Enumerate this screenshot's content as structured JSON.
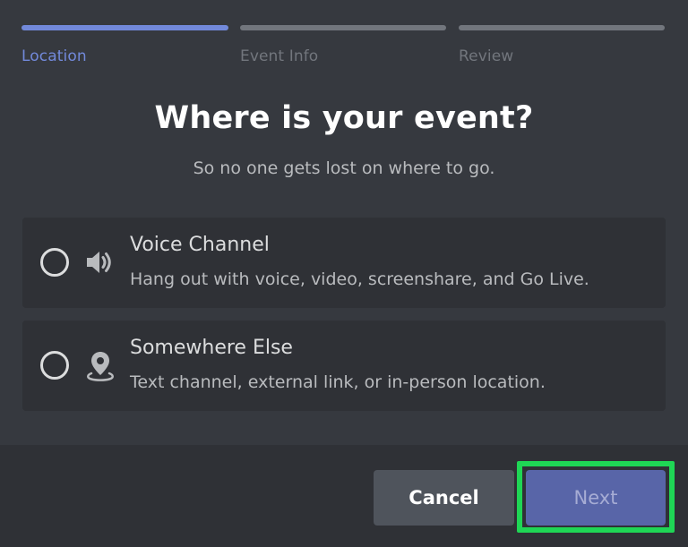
{
  "stepper": {
    "steps": [
      {
        "label": "Location",
        "active": true
      },
      {
        "label": "Event Info",
        "active": false
      },
      {
        "label": "Review",
        "active": false
      }
    ]
  },
  "header": {
    "title": "Where is your event?",
    "subtitle": "So no one gets lost on where to go."
  },
  "options": [
    {
      "icon": "speaker-icon",
      "title": "Voice Channel",
      "description": "Hang out with voice, video, screenshare, and Go Live.",
      "selected": false
    },
    {
      "icon": "location-pin-icon",
      "title": "Somewhere Else",
      "description": "Text channel, external link, or in-person location.",
      "selected": false
    }
  ],
  "footer": {
    "cancel_label": "Cancel",
    "next_label": "Next"
  },
  "colors": {
    "accent": "#7289da",
    "highlight": "#1fd655",
    "background": "#36393f"
  }
}
